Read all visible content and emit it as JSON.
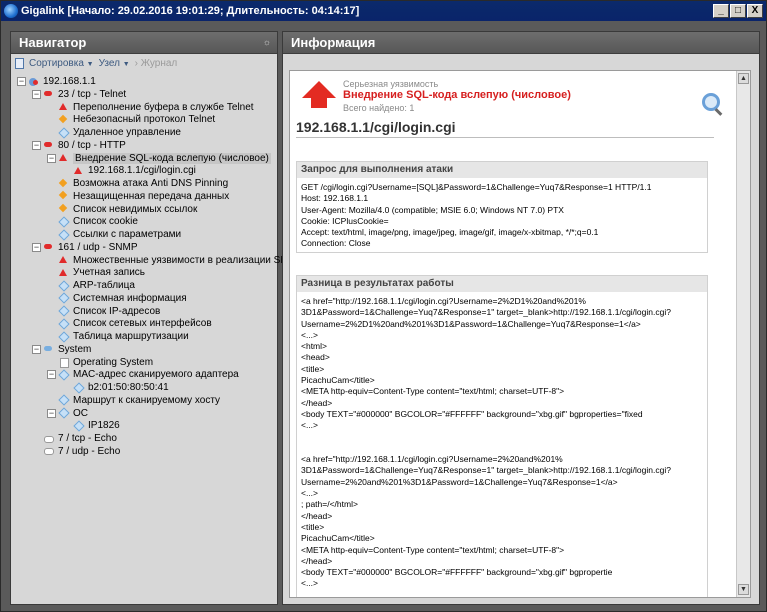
{
  "window": {
    "title": "Gigalink [Начало: 29.02.2016 19:01:29; Длительность: 04:14:17]",
    "btn_min": "_",
    "btn_max": "□",
    "btn_close": "X"
  },
  "navigator": {
    "title": "Навигатор",
    "pin": "☼",
    "toolbar": {
      "sort": "Сортировка",
      "node": "Узел",
      "journal": "Журнал"
    },
    "tree": [
      {
        "label": "192.168.1.1",
        "icon": "host-icon"
      },
      {
        "label": "23 / tcp - Telnet",
        "icon": "port-red-icon"
      },
      {
        "label": "Переполнение буфера в службе Telnet",
        "icon": "high-severity-icon"
      },
      {
        "label": "Небезопасный протокол Telnet",
        "icon": "medium-severity-icon"
      },
      {
        "label": "Удаленное управление",
        "icon": "info-icon"
      },
      {
        "label": "80 / tcp - HTTP",
        "icon": "port-red-icon"
      },
      {
        "label": "Внедрение SQL-кода вслепую (числовое)",
        "icon": "high-severity-icon"
      },
      {
        "label": "192.168.1.1/cgi/login.cgi",
        "icon": "high-severity-icon"
      },
      {
        "label": "Возможна атака Anti DNS Pinning",
        "icon": "medium-severity-icon"
      },
      {
        "label": "Незащищенная передача данных",
        "icon": "medium-severity-icon"
      },
      {
        "label": "Список невидимых ссылок",
        "icon": "medium-severity-icon"
      },
      {
        "label": "Список cookie",
        "icon": "info-icon"
      },
      {
        "label": "Ссылки с параметрами",
        "icon": "info-icon"
      },
      {
        "label": "161 / udp - SNMP",
        "icon": "port-red-icon"
      },
      {
        "label": "Множественные уязвимости в реализации SNMP",
        "icon": "high-severity-icon"
      },
      {
        "label": "Учетная запись",
        "icon": "high-severity-icon"
      },
      {
        "label": "ARP-таблица",
        "icon": "info-icon"
      },
      {
        "label": "Системная информация",
        "icon": "info-icon"
      },
      {
        "label": "Список IP-адресов",
        "icon": "info-icon"
      },
      {
        "label": "Список сетевых интерфейсов",
        "icon": "info-icon"
      },
      {
        "label": "Таблица маршрутизации",
        "icon": "info-icon"
      },
      {
        "label": "System",
        "icon": "port-blue-icon"
      },
      {
        "label": "Operating System",
        "icon": "page-icon"
      },
      {
        "label": "MAC-адрес сканируемого адаптера",
        "icon": "info-icon"
      },
      {
        "label": "b2:01:50:80:50:41",
        "icon": "info-icon"
      },
      {
        "label": "Маршрут к сканируемому хосту",
        "icon": "info-icon"
      },
      {
        "label": "ОС",
        "icon": "info-icon"
      },
      {
        "label": "IP1826",
        "icon": "info-icon"
      },
      {
        "label": "7 / tcp - Echo",
        "icon": "port-white-icon"
      },
      {
        "label": "7 / udp - Echo",
        "icon": "port-white-icon"
      }
    ]
  },
  "info": {
    "title": "Информация",
    "severity": "Серьезная уязвимость",
    "vuln_name": "Внедрение SQL-кода вслепую (числовое)",
    "found": "Всего найдено: 1",
    "url": "192.168.1.1/cgi/login.cgi",
    "request": {
      "title": "Запрос для выполнения атаки",
      "body": "GET /cgi/login.cgi?Username=[SQL]&Password=1&Challenge=Yuq7&Response=1 HTTP/1.1\nHost: 192.168.1.1\nUser-Agent: Mozilla/4.0 (compatible; MSIE 6.0; Windows NT 7.0) PTX\nCookie: ICPlusCookie=\nAccept: text/html, image/png, image/jpeg, image/gif, image/x-xbitmap, */*;q=0.1\nConnection: Close"
    },
    "diff": {
      "title": "Разница в результатах работы",
      "body": "<a href=\"http://192.168.1.1/cgi/login.cgi?Username=2%2D1%20and%201%\n3D1&Password=1&Challenge=Yuq7&Response=1\" target=_blank>http://192.168.1.1/cgi/login.cgi?\nUsername=2%2D1%20and%201%3D1&Password=1&Challenge=Yuq7&Response=1</a>\n<...>\n<html>\n<head>\n<title>\nPicachuCam</title>\n<META http-equiv=Content-Type content=\"text/html; charset=UTF-8\">\n</head>\n<body TEXT=\"#000000\" BGCOLOR=\"#FFFFFF\" background=\"xbg.gif\" bgproperties=\"fixed\n<...>\n\n\n<a href=\"http://192.168.1.1/cgi/login.cgi?Username=2%20and%201%\n3D1&Password=1&Challenge=Yuq7&Response=1\" target=_blank>http://192.168.1.1/cgi/login.cgi?\nUsername=2%20and%201%3D1&Password=1&Challenge=Yuq7&Response=1</a>\n<...>\n; path=/</html>\n</head>\n<title>\nPicachuCam</title>\n<META http-equiv=Content-Type content=\"text/html; charset=UTF-8\">\n</head>\n<body TEXT=\"#000000\" BGCOLOR=\"#FFFFFF\" background=\"xbg.gif\" bgpropertie\n<...>"
    }
  }
}
